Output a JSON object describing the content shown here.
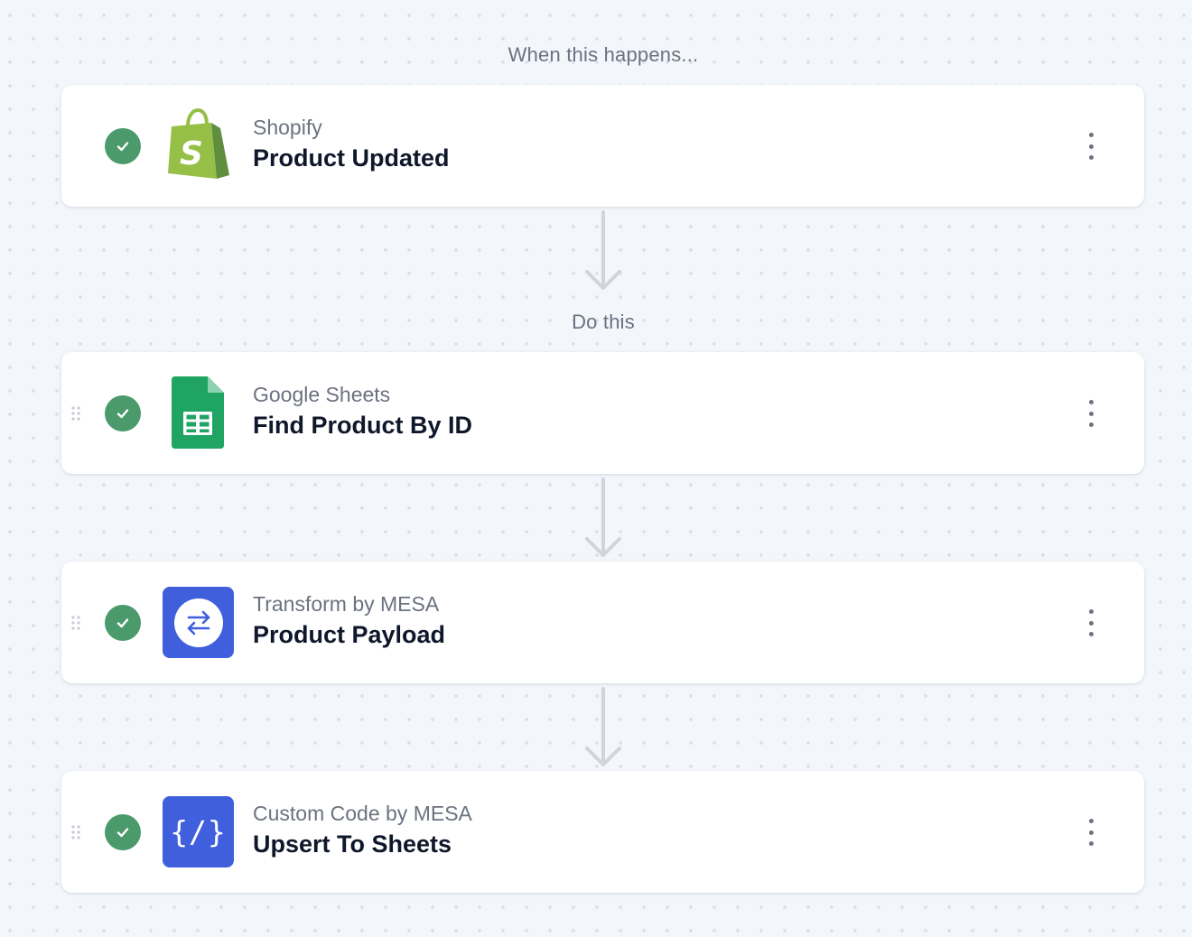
{
  "labels": {
    "trigger_heading": "When this happens...",
    "actions_heading": "Do this"
  },
  "steps": [
    {
      "app": "Shopify",
      "title": "Product Updated",
      "icon": "shopify-bag-icon",
      "status": "complete"
    },
    {
      "app": "Google Sheets",
      "title": "Find Product By ID",
      "icon": "google-sheets-icon",
      "status": "complete"
    },
    {
      "app": "Transform by MESA",
      "title": "Product Payload",
      "icon": "transform-arrows-icon",
      "status": "complete"
    },
    {
      "app": "Custom Code by MESA",
      "title": "Upsert To Sheets",
      "icon": "code-braces-icon",
      "status": "complete"
    }
  ],
  "icon_glyphs": {
    "code": "{/}"
  },
  "colors": {
    "check_green": "#4a9a6b",
    "mesa_blue": "#3f5fdc",
    "sheets_green": "#1fa463",
    "shopify_green": "#95bf47",
    "canvas": "#f3f6fb",
    "connector_gray": "#d1d5db"
  }
}
